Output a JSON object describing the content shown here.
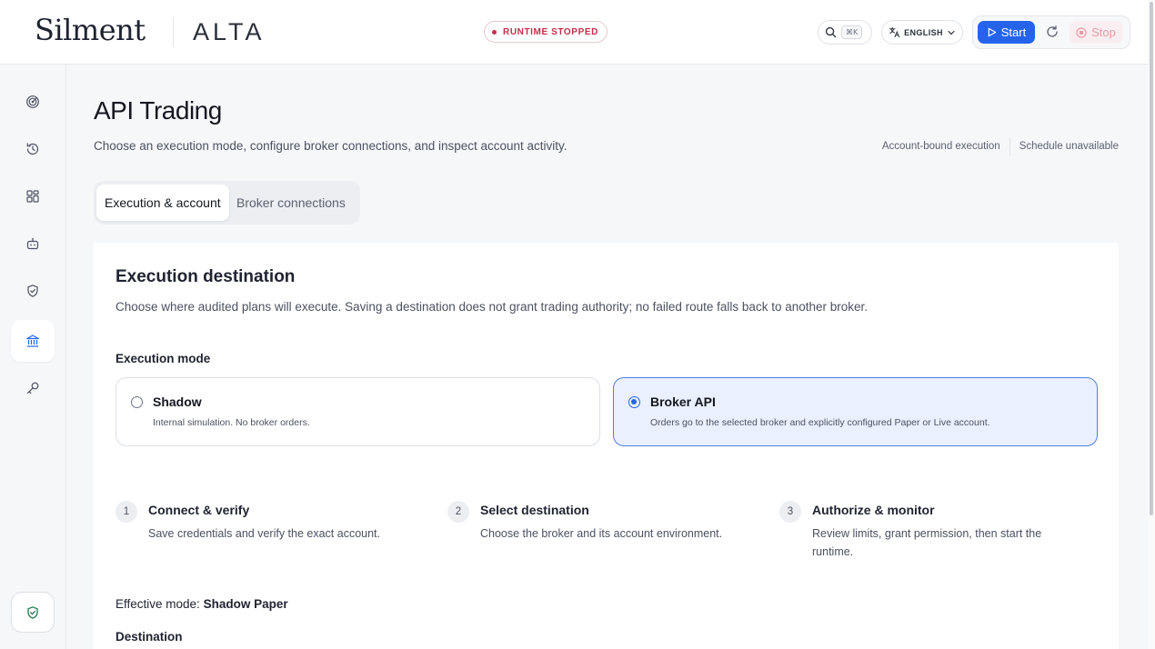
{
  "header": {
    "brand": "Silment",
    "product": "ALTA",
    "runtime_status": "RUNTIME STOPPED",
    "search_shortcut": "⌘K",
    "language": "ENGLISH",
    "start_label": "Start",
    "stop_label": "Stop"
  },
  "sidebar": {
    "items": [
      {
        "icon": "radar-icon"
      },
      {
        "icon": "history-icon"
      },
      {
        "icon": "dashboard-grid-icon"
      },
      {
        "icon": "robot-icon"
      },
      {
        "icon": "shield-check-icon"
      },
      {
        "icon": "bank-icon",
        "active": true
      },
      {
        "icon": "key-icon"
      }
    ],
    "bottom_icon": "shield-check-icon"
  },
  "page": {
    "title": "API Trading",
    "subtitle": "Choose an execution mode, configure broker connections, and inspect account activity.",
    "meta": [
      "Account-bound execution",
      "Schedule unavailable"
    ],
    "tabs": [
      {
        "label": "Execution & account",
        "active": true
      },
      {
        "label": "Broker connections",
        "active": false
      }
    ]
  },
  "execution": {
    "title": "Execution destination",
    "description": "Choose where audited plans will execute. Saving a destination does not grant trading authority; no failed route falls back to another broker.",
    "mode_label": "Execution mode",
    "modes": [
      {
        "title": "Shadow",
        "description": "Internal simulation. No broker orders.",
        "selected": false
      },
      {
        "title": "Broker API",
        "description": "Orders go to the selected broker and explicitly configured Paper or Live account.",
        "selected": true
      }
    ],
    "steps": [
      {
        "num": "1",
        "title": "Connect & verify",
        "description": "Save credentials and verify the exact account."
      },
      {
        "num": "2",
        "title": "Select destination",
        "description": "Choose the broker and its account environment."
      },
      {
        "num": "3",
        "title": "Authorize & monitor",
        "description": "Review limits, grant permission, then start the runtime."
      }
    ],
    "effective_mode_prefix": "Effective mode:",
    "effective_mode_value": "Shadow Paper",
    "destination_label": "Destination"
  },
  "colors": {
    "accent": "#2563eb",
    "danger": "#c0304a",
    "selected_bg": "#eaf0fd"
  }
}
